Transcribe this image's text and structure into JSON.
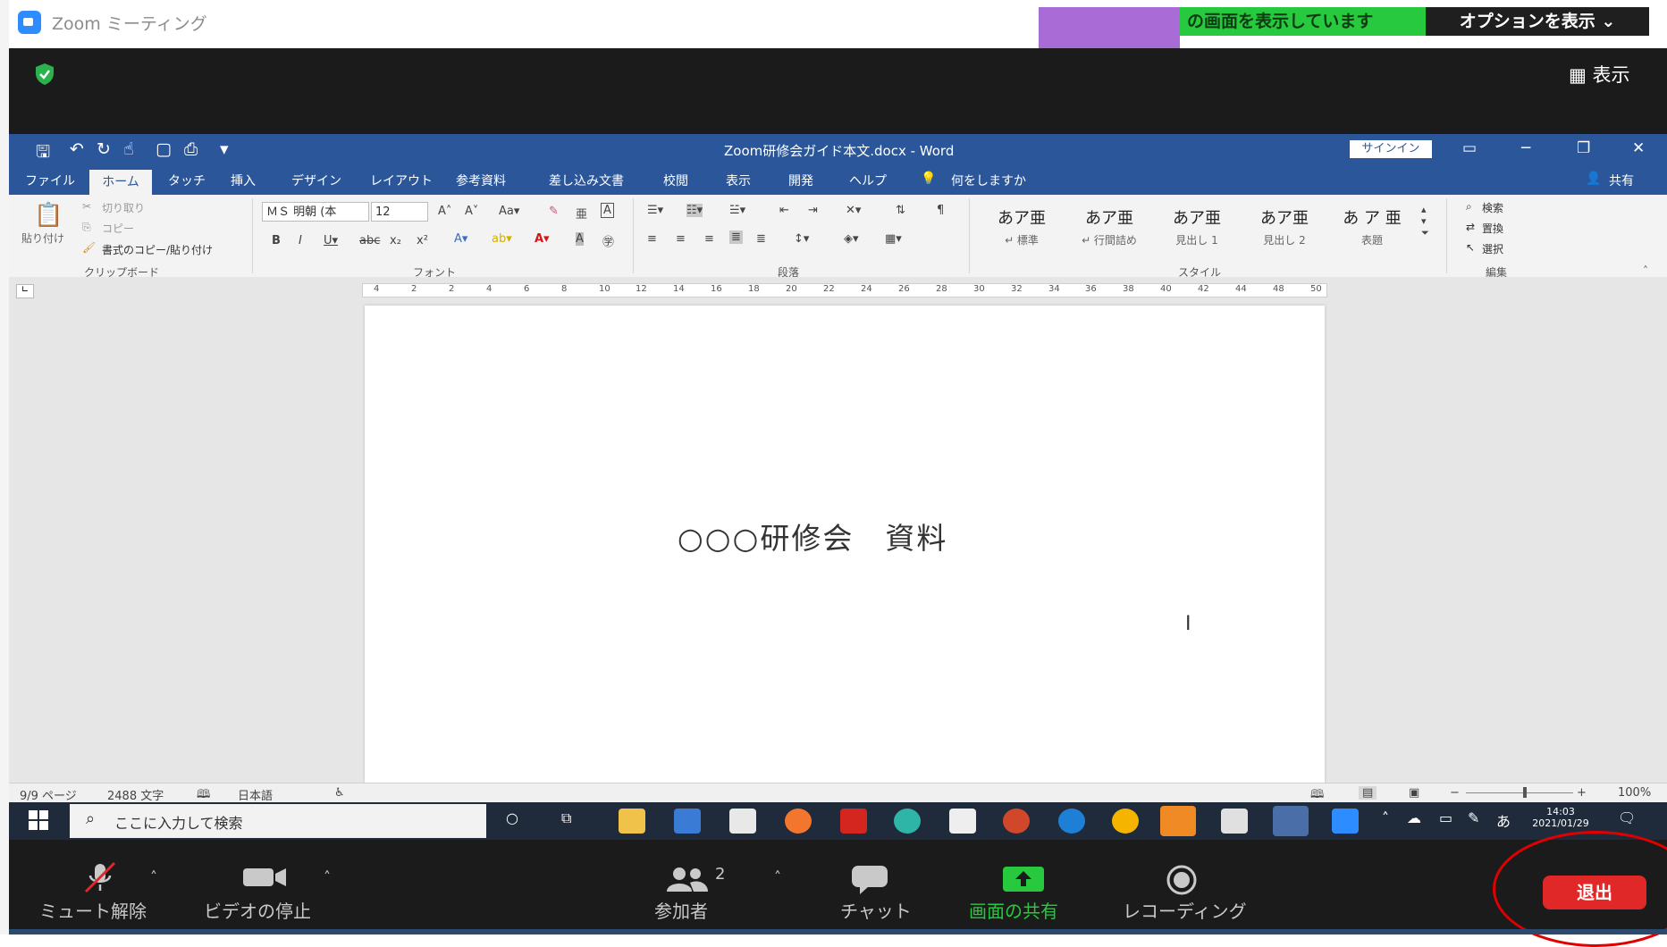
{
  "zoom_window": {
    "title": "Zoom ミーティング",
    "share_banner": "の画面を表示しています",
    "options_label": "オプションを表示 ⌄",
    "view_label": "表示"
  },
  "word": {
    "doc_title": "Zoom研修会ガイド本文.docx  -  Word",
    "signin_label": "サインイン",
    "tabs": [
      "ファイル",
      "ホーム",
      "タッチ",
      "挿入",
      "デザイン",
      "レイアウト",
      "参考資料",
      "差し込み文書",
      "校閲",
      "表示",
      "開発",
      "ヘルプ"
    ],
    "tell_me": "何をしますか",
    "share_label": "共有",
    "clipboard": {
      "paste": "貼り付け",
      "cut": "切り取り",
      "copy": "コピー",
      "format_painter": "書式のコピー/貼り付け",
      "group": "クリップボード"
    },
    "font": {
      "name": "ＭＳ 明朝 (本",
      "size": "12",
      "group": "フォント"
    },
    "paragraph_group": "段落",
    "styles": [
      {
        "sample": "あア亜",
        "name": "↵ 標準"
      },
      {
        "sample": "あア亜",
        "name": "↵ 行間詰め"
      },
      {
        "sample": "あア亜",
        "name": "見出し 1"
      },
      {
        "sample": "あア亜",
        "name": "見出し 2"
      },
      {
        "sample": "あ ア 亜",
        "name": "表題"
      }
    ],
    "styles_group": "スタイル",
    "editing": {
      "find": "検索",
      "replace": "置換",
      "select": "選択",
      "group": "編集"
    },
    "ruler_numbers": [
      "4",
      "2",
      "2",
      "4",
      "6",
      "8",
      "10",
      "12",
      "14",
      "16",
      "18",
      "20",
      "22",
      "24",
      "26",
      "28",
      "30",
      "32",
      "34",
      "36",
      "38",
      "40",
      "42",
      "44",
      "48",
      "50"
    ],
    "document_heading": "○○○研修会　資料",
    "status": {
      "page": "9/9 ページ",
      "words": "2488 文字",
      "language": "日本語",
      "zoom": "100%"
    }
  },
  "taskbar": {
    "search_placeholder": "ここに入力して検索",
    "time": "14:03",
    "date": "2021/01/29",
    "ime": "あ"
  },
  "zoom_controls": {
    "mute": "ミュート解除",
    "video": "ビデオの停止",
    "participants": "参加者",
    "participants_count": "2",
    "chat": "チャット",
    "share": "画面の共有",
    "record": "レコーディング",
    "leave": "退出"
  },
  "colors": {
    "word_blue": "#2b579a",
    "share_green": "#27c93f",
    "leave_red": "#e02828",
    "highlight_circle": "#e00000"
  }
}
